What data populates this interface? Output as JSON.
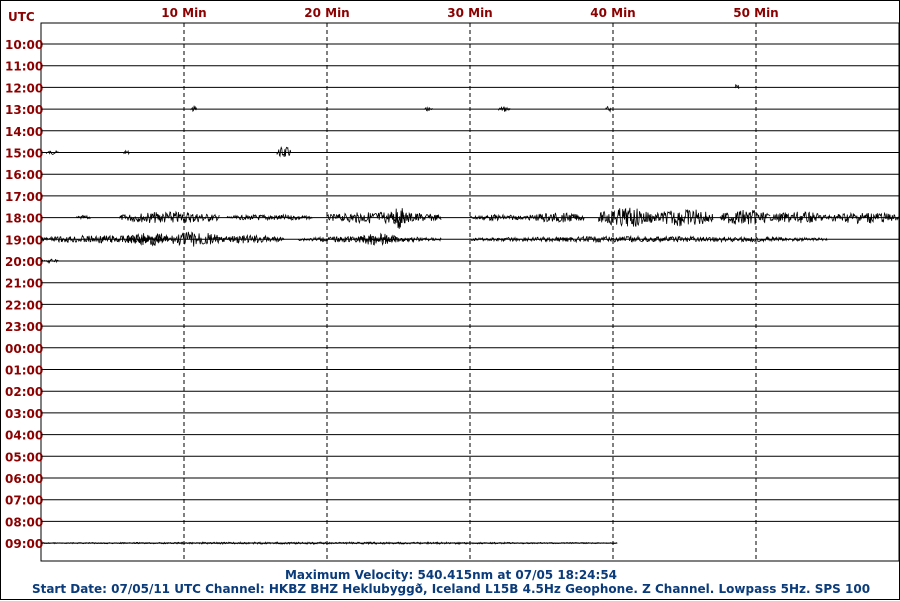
{
  "chart_data": {
    "type": "line",
    "title": "",
    "corner_label": "UTC",
    "x_ticks": [
      {
        "minute": 10,
        "label": "10 Min"
      },
      {
        "minute": 20,
        "label": "20 Min"
      },
      {
        "minute": 30,
        "label": "30 Min"
      },
      {
        "minute": 40,
        "label": "40 Min"
      },
      {
        "minute": 50,
        "label": "50 Min"
      }
    ],
    "xlim_minutes": [
      0,
      60
    ],
    "hours": [
      "10:00",
      "11:00",
      "12:00",
      "13:00",
      "14:00",
      "15:00",
      "16:00",
      "17:00",
      "18:00",
      "19:00",
      "20:00",
      "21:00",
      "22:00",
      "23:00",
      "00:00",
      "01:00",
      "02:00",
      "03:00",
      "04:00",
      "05:00",
      "06:00",
      "07:00",
      "08:00",
      "09:00"
    ],
    "trace_color": "#000000",
    "baseline_color": "#000000",
    "gridline_color": "#000000",
    "label_color": "#8b0000",
    "footer_color": "#0a3b7a",
    "grid": true,
    "last_trace_end_minute": 40.3,
    "events": [
      {
        "hour": "12:00",
        "minute": 48.5,
        "amplitude": 4,
        "duration": 0.3
      },
      {
        "hour": "13:00",
        "minute": 10.5,
        "amplitude": 4,
        "duration": 0.4
      },
      {
        "hour": "13:00",
        "minute": 26.8,
        "amplitude": 2,
        "duration": 0.6
      },
      {
        "hour": "13:00",
        "minute": 32.0,
        "amplitude": 3,
        "duration": 0.8
      },
      {
        "hour": "13:00",
        "minute": 39.5,
        "amplitude": 3,
        "duration": 0.4
      },
      {
        "hour": "15:00",
        "minute": 0.3,
        "amplitude": 2,
        "duration": 1.0
      },
      {
        "hour": "15:00",
        "minute": 5.8,
        "amplitude": 2,
        "duration": 0.4
      },
      {
        "hour": "15:00",
        "minute": 16.5,
        "amplitude": 6,
        "duration": 1.0
      },
      {
        "hour": "18:00",
        "minute": 2.5,
        "amplitude": 2,
        "duration": 1.0
      },
      {
        "hour": "18:00",
        "minute": 5.5,
        "amplitude": 6,
        "duration": 7.0
      },
      {
        "hour": "18:00",
        "minute": 13.0,
        "amplitude": 3,
        "duration": 6.0
      },
      {
        "hour": "18:00",
        "minute": 20.0,
        "amplitude": 6,
        "duration": 8.0
      },
      {
        "hour": "18:00",
        "minute": 24.5,
        "amplitude": 12,
        "duration": 1.0
      },
      {
        "hour": "18:00",
        "minute": 30.0,
        "amplitude": 3,
        "duration": 4.0
      },
      {
        "hour": "18:00",
        "minute": 34.0,
        "amplitude": 5,
        "duration": 4.0
      },
      {
        "hour": "18:00",
        "minute": 39.0,
        "amplitude": 10,
        "duration": 4.0
      },
      {
        "hour": "18:00",
        "minute": 43.0,
        "amplitude": 9,
        "duration": 4.0
      },
      {
        "hour": "18:00",
        "minute": 47.5,
        "amplitude": 8,
        "duration": 3.5
      },
      {
        "hour": "18:00",
        "minute": 51.0,
        "amplitude": 6,
        "duration": 4.0
      },
      {
        "hour": "18:00",
        "minute": 55.0,
        "amplitude": 6,
        "duration": 5.0
      },
      {
        "hour": "19:00",
        "minute": 0.0,
        "amplitude": 4,
        "duration": 9.0
      },
      {
        "hour": "19:00",
        "minute": 6.0,
        "amplitude": 7,
        "duration": 3.0
      },
      {
        "hour": "19:00",
        "minute": 9.0,
        "amplitude": 8,
        "duration": 3.5
      },
      {
        "hour": "19:00",
        "minute": 12.0,
        "amplitude": 4,
        "duration": 5.0
      },
      {
        "hour": "19:00",
        "minute": 18.0,
        "amplitude": 3,
        "duration": 10.0
      },
      {
        "hour": "19:00",
        "minute": 22.0,
        "amplitude": 6,
        "duration": 3.0
      },
      {
        "hour": "19:00",
        "minute": 30.0,
        "amplitude": 3,
        "duration": 25.0
      },
      {
        "hour": "20:00",
        "minute": 0.0,
        "amplitude": 2,
        "duration": 1.3
      },
      {
        "hour": "09:00",
        "minute": 0.0,
        "amplitude": 1,
        "duration": 40.3
      }
    ]
  },
  "footer": {
    "line1": "Maximum Velocity: 540.415nm at 07/05 18:24:54",
    "line2": "Start Date: 07/05/11 UTC Channel: HKBZ  BHZ  Heklubyggð, Iceland  L15B 4.5Hz Geophone. Z Channel. Lowpass 5Hz. SPS 100"
  }
}
